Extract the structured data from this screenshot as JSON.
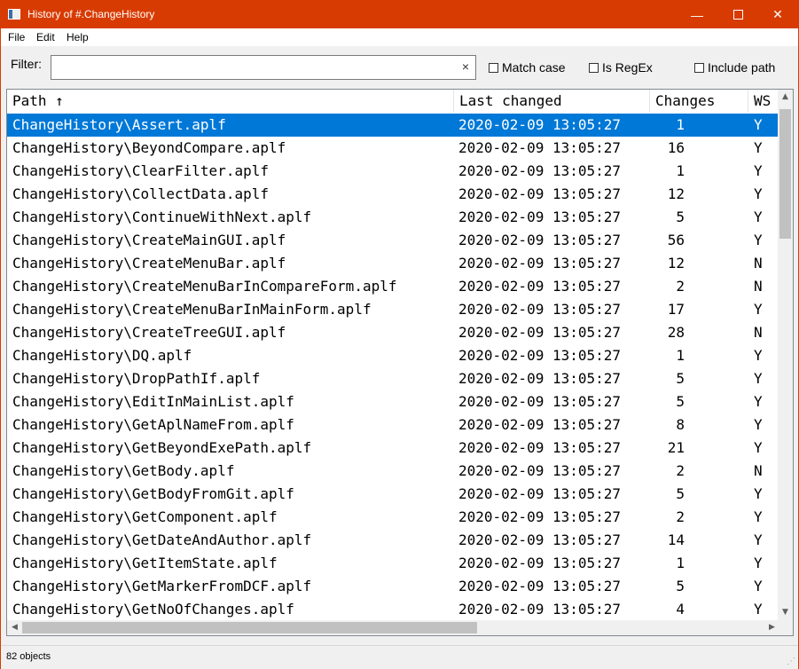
{
  "window": {
    "title": "History of #.ChangeHistory"
  },
  "menu": [
    "File",
    "Edit",
    "Help"
  ],
  "filter": {
    "label": "Filter:",
    "value": "",
    "clear_glyph": "×"
  },
  "options": [
    {
      "label": "Match case",
      "checked": false
    },
    {
      "label": "Is RegEx",
      "checked": false
    },
    {
      "label": "Include path",
      "checked": false
    }
  ],
  "columns": [
    "Path ↑",
    "Last changed",
    "Changes",
    "WS"
  ],
  "rows": [
    {
      "path": "ChangeHistory\\Assert.aplf",
      "date": "2020-02-09 13:05:27",
      "changes": "1",
      "ws": "Y"
    },
    {
      "path": "ChangeHistory\\BeyondCompare.aplf",
      "date": "2020-02-09 13:05:27",
      "changes": "16",
      "ws": "Y"
    },
    {
      "path": "ChangeHistory\\ClearFilter.aplf",
      "date": "2020-02-09 13:05:27",
      "changes": "1",
      "ws": "Y"
    },
    {
      "path": "ChangeHistory\\CollectData.aplf",
      "date": "2020-02-09 13:05:27",
      "changes": "12",
      "ws": "Y"
    },
    {
      "path": "ChangeHistory\\ContinueWithNext.aplf",
      "date": "2020-02-09 13:05:27",
      "changes": "5",
      "ws": "Y"
    },
    {
      "path": "ChangeHistory\\CreateMainGUI.aplf",
      "date": "2020-02-09 13:05:27",
      "changes": "56",
      "ws": "Y"
    },
    {
      "path": "ChangeHistory\\CreateMenuBar.aplf",
      "date": "2020-02-09 13:05:27",
      "changes": "12",
      "ws": "N"
    },
    {
      "path": "ChangeHistory\\CreateMenuBarInCompareForm.aplf",
      "date": "2020-02-09 13:05:27",
      "changes": "2",
      "ws": "N"
    },
    {
      "path": "ChangeHistory\\CreateMenuBarInMainForm.aplf",
      "date": "2020-02-09 13:05:27",
      "changes": "17",
      "ws": "Y"
    },
    {
      "path": "ChangeHistory\\CreateTreeGUI.aplf",
      "date": "2020-02-09 13:05:27",
      "changes": "28",
      "ws": "N"
    },
    {
      "path": "ChangeHistory\\DQ.aplf",
      "date": "2020-02-09 13:05:27",
      "changes": "1",
      "ws": "Y"
    },
    {
      "path": "ChangeHistory\\DropPathIf.aplf",
      "date": "2020-02-09 13:05:27",
      "changes": "5",
      "ws": "Y"
    },
    {
      "path": "ChangeHistory\\EditInMainList.aplf",
      "date": "2020-02-09 13:05:27",
      "changes": "5",
      "ws": "Y"
    },
    {
      "path": "ChangeHistory\\GetAplNameFrom.aplf",
      "date": "2020-02-09 13:05:27",
      "changes": "8",
      "ws": "Y"
    },
    {
      "path": "ChangeHistory\\GetBeyondExePath.aplf",
      "date": "2020-02-09 13:05:27",
      "changes": "21",
      "ws": "Y"
    },
    {
      "path": "ChangeHistory\\GetBody.aplf",
      "date": "2020-02-09 13:05:27",
      "changes": "2",
      "ws": "N"
    },
    {
      "path": "ChangeHistory\\GetBodyFromGit.aplf",
      "date": "2020-02-09 13:05:27",
      "changes": "5",
      "ws": "Y"
    },
    {
      "path": "ChangeHistory\\GetComponent.aplf",
      "date": "2020-02-09 13:05:27",
      "changes": "2",
      "ws": "Y"
    },
    {
      "path": "ChangeHistory\\GetDateAndAuthor.aplf",
      "date": "2020-02-09 13:05:27",
      "changes": "14",
      "ws": "Y"
    },
    {
      "path": "ChangeHistory\\GetItemState.aplf",
      "date": "2020-02-09 13:05:27",
      "changes": "1",
      "ws": "Y"
    },
    {
      "path": "ChangeHistory\\GetMarkerFromDCF.aplf",
      "date": "2020-02-09 13:05:27",
      "changes": "5",
      "ws": "Y"
    },
    {
      "path": "ChangeHistory\\GetNoOfChanges.aplf",
      "date": "2020-02-09 13:05:27",
      "changes": "4",
      "ws": "Y"
    }
  ],
  "selected_row": 0,
  "status": {
    "text": "82 objects"
  },
  "colors": {
    "titlebar": "#d83b01",
    "selection": "#0078d7"
  }
}
